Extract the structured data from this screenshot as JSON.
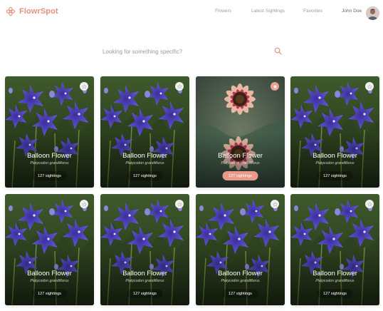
{
  "app": {
    "name": "FlowrSpot"
  },
  "nav": {
    "flowers": "Flowers",
    "latest_sightings": "Latest Sightings",
    "favorites": "Favorites",
    "user_name": "John Doe"
  },
  "search": {
    "placeholder": "Looking for something specific?"
  },
  "colors": {
    "brand": "#e5907f",
    "nav_text": "#949ea0",
    "sightings_active": "#ea9a8a"
  },
  "cards": [
    {
      "name": "Balloon Flower",
      "latin": "Platycodon grandiflorus",
      "sightings": "127 sightings",
      "image": "balloon-flower",
      "favorite": false
    },
    {
      "name": "Balloon Flower",
      "latin": "Platycodon grandiflorus",
      "sightings": "127 sightings",
      "image": "balloon-flower",
      "favorite": false
    },
    {
      "name": "Balloon Flower",
      "latin": "Platycodon grandiflorus",
      "sightings": "127 sightings",
      "image": "sunflower",
      "favorite": true
    },
    {
      "name": "Balloon Flower",
      "latin": "Platycodon grandiflorus",
      "sightings": "127 sightings",
      "image": "balloon-flower",
      "favorite": false
    },
    {
      "name": "Balloon Flower",
      "latin": "Platycodon grandiflorus",
      "sightings": "127 sightings",
      "image": "balloon-flower",
      "favorite": false
    },
    {
      "name": "Balloon Flower",
      "latin": "Platycodon grandiflorus",
      "sightings": "127 sightings",
      "image": "balloon-flower",
      "favorite": false
    },
    {
      "name": "Balloon Flower",
      "latin": "Platycodon grandiflorus",
      "sightings": "127 sightings",
      "image": "balloon-flower",
      "favorite": false
    },
    {
      "name": "Balloon Flower",
      "latin": "Platycodon grandiflorus",
      "sightings": "127 sightings",
      "image": "balloon-flower",
      "favorite": false
    }
  ]
}
